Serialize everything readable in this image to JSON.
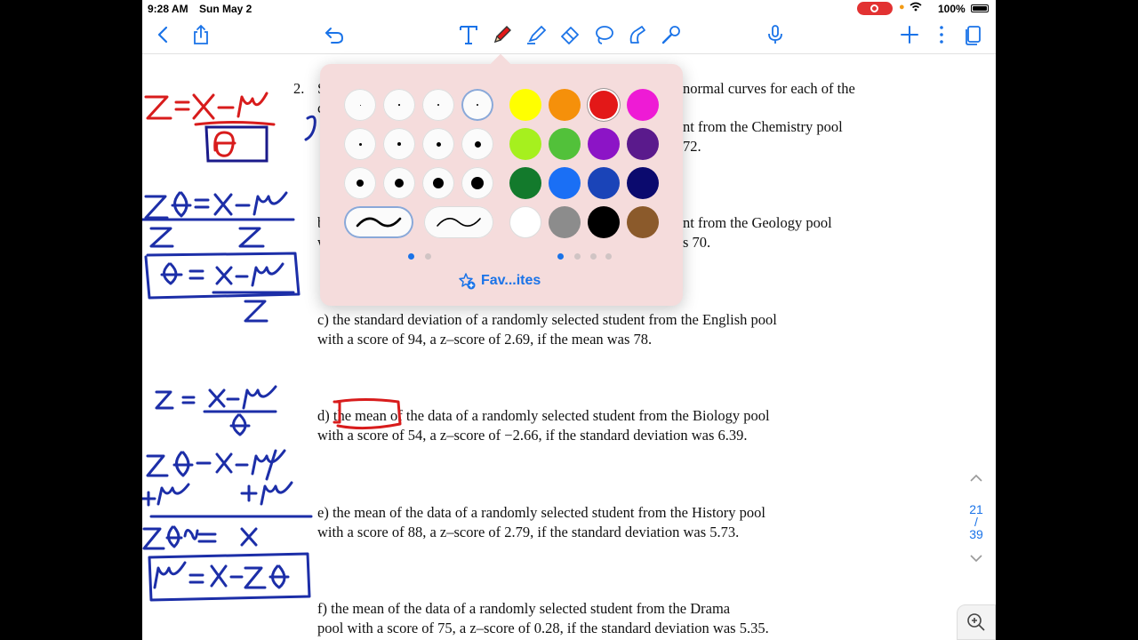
{
  "status": {
    "time": "9:28 AM",
    "date": "Sun May 2",
    "battery": "100%"
  },
  "toolbar": {
    "tools": [
      "back-icon",
      "share-icon",
      "undo-icon",
      "text-tool-icon",
      "pen-tool-icon",
      "highlighter-tool-icon",
      "eraser-tool-icon",
      "lasso-tool-icon",
      "shapes-tool-icon",
      "laser-pointer-icon",
      "microphone-icon",
      "add-page-icon",
      "more-icon",
      "pages-icon"
    ],
    "accent": "#1a73e8",
    "selected_tool": "pen-tool-icon"
  },
  "document": {
    "q_number": "2.",
    "q_first_letter": "S",
    "frag_1": "normal curves for each of the",
    "frag_1b": "c",
    "frag_2": "nt from the Chemistry pool",
    "frag_3": "72.",
    "frag_4a": "b",
    "frag_4": "nt from the Geology pool",
    "frag_5a": "w",
    "frag_5": "s 70.",
    "c1": "c) the standard deviation of a randomly selected student from the English pool",
    "c2": "with a score of 94, a z–score of 2.69, if the mean was 78.",
    "d1": "d) the mean of the data of a randomly selected student from the Biology pool",
    "d2": "with a score of 54, a z–score of −2.66, if the standard deviation was 6.39.",
    "e1": "e) the mean of the data of a randomly selected student from the History pool",
    "e2": "with a score of 88, a z–score of 2.79, if the standard deviation was 5.73.",
    "f1": "f) the mean of the data of a randomly selected student from the Drama",
    "f2": "pool with a score of 75, a z–score of 0.28, if the standard deviation was 5.35."
  },
  "pen_popup": {
    "thickness_levels": 12,
    "selected_thickness_index": 3,
    "stroke_styles": [
      "pressure",
      "uniform"
    ],
    "selected_stroke_style": 0,
    "colors": [
      "#ffff00",
      "#f5900a",
      "#e31818",
      "#ee1bd5",
      "#a6f01e",
      "#52c13a",
      "#8c14c6",
      "#5a1a8c",
      "#137a2c",
      "#1a6ff5",
      "#1a44b8",
      "#0b0a6e",
      "#ffffff",
      "#8c8c8c",
      "#000000",
      "#8b5a2b"
    ],
    "selected_color_index": 2,
    "favorites_label": "Fav...ites",
    "thickness_page": "1 of 2",
    "color_page": "1 of 4"
  },
  "page_nav": {
    "current": "21",
    "separator": "/",
    "total": "39"
  }
}
